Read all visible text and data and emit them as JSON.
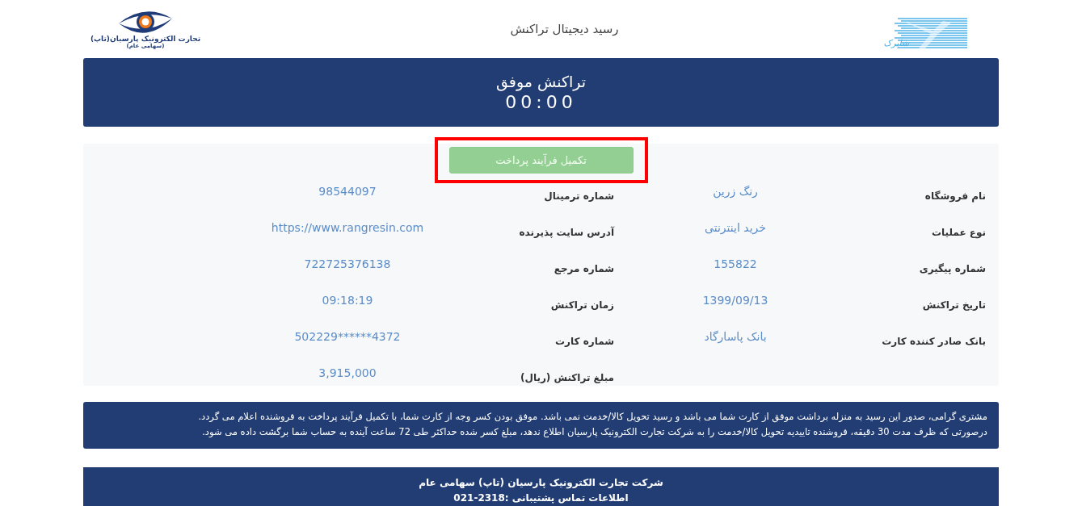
{
  "header": {
    "title": "رسید دیجیتال تراکنش",
    "left_logo": {
      "name": "تجارت الکترونیک پارسیان(تاپ)",
      "subname": "(سهامی عام)"
    },
    "right_logo": {
      "name": "شاپرک"
    }
  },
  "banner": {
    "status": "تراکنش موفق",
    "timer": "00:00"
  },
  "action": {
    "label": "تکمیل فرآیند پرداخت",
    "disabled": true,
    "highlighted": true
  },
  "fields": [
    {
      "right": {
        "label": "نام فروشگاه",
        "value": "رنگ زرین"
      },
      "left": {
        "label": "شماره ترمینال",
        "value": "98544097"
      }
    },
    {
      "right": {
        "label": "نوع عملیات",
        "value": "خرید اینترنتی"
      },
      "left": {
        "label": "آدرس سایت پذیرنده",
        "value": "https://www.rangresin.com"
      }
    },
    {
      "right": {
        "label": "شماره پیگیری",
        "value": "155822"
      },
      "left": {
        "label": "شماره مرجع",
        "value": "722725376138"
      }
    },
    {
      "right": {
        "label": "تاریخ تراکنش",
        "value": "1399/09/13"
      },
      "left": {
        "label": "زمان تراکنش",
        "value": "09:18:19"
      }
    },
    {
      "right": {
        "label": "بانک صادر کننده کارت",
        "value": "بانک پاسارگاد"
      },
      "left": {
        "label": "شماره کارت",
        "value": "502229******4372"
      }
    },
    {
      "left": {
        "label": "مبلغ تراکنش (ریال)",
        "value": "3,915,000"
      }
    }
  ],
  "notice": [
    "مشتری گرامی، صدور این رسید به منزله برداشت موفق از کارت شما می باشد و رسید تحویل کالا/خدمت نمی باشد. موفق بودن کسر وجه از کارت شما، با تکمیل فرآیند پرداخت به فروشنده اعلام می گردد.",
    "درصورتی که ظرف مدت 30 دقیقه، فروشنده تاییدیه تحویل کالا/خدمت را به شرکت تجارت الکترونیک پارسیان اطلاع ندهد، مبلغ کسر شده حداکثر طی 72 ساعت آینده به حساب شما برگشت داده می شود."
  ],
  "footer": [
    "شرکت تجارت الکترونیک پارسیان (تاپ) سهامی عام",
    "اطلاعات تماس پشتیبانی :2318-021"
  ]
}
